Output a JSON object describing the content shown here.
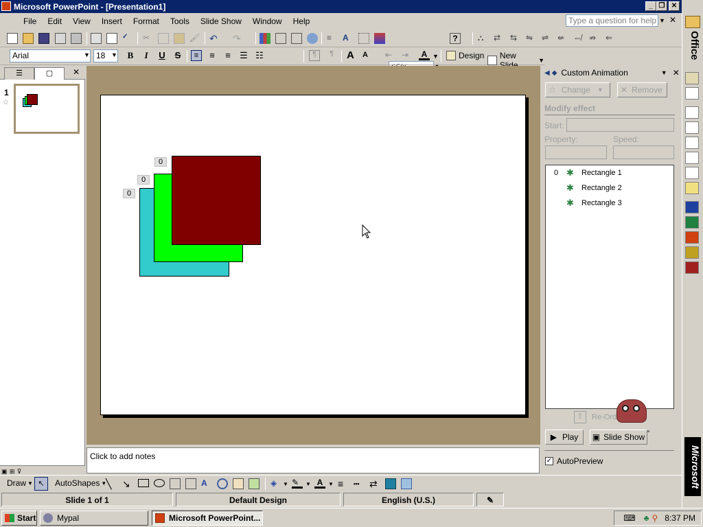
{
  "window": {
    "title": "Microsoft PowerPoint - [Presentation1]",
    "help_placeholder": "Type a question for help"
  },
  "menu": [
    "File",
    "Edit",
    "View",
    "Insert",
    "Format",
    "Tools",
    "Slide Show",
    "Window",
    "Help"
  ],
  "toolbar": {
    "zoom": "65%",
    "design_label": "Design",
    "new_slide_label": "New Slide",
    "font_name": "Arial",
    "font_size": "18"
  },
  "slides_pane": {
    "slide_number": "1"
  },
  "slide": {
    "rectangles": [
      {
        "name": "Rectangle 1",
        "color": "#33cccc",
        "order": "0"
      },
      {
        "name": "Rectangle 2",
        "color": "#00ff00",
        "order": "0"
      },
      {
        "name": "Rectangle 3",
        "color": "#800000",
        "order": "0"
      }
    ]
  },
  "notes": {
    "placeholder": "Click to add notes"
  },
  "task_pane": {
    "title": "Custom Animation",
    "change_label": "Change",
    "remove_label": "Remove",
    "modify_effect": "Modify effect",
    "start_label": "Start:",
    "property_label": "Property:",
    "speed_label": "Speed:",
    "list": [
      {
        "order": "0",
        "name": "Rectangle 1"
      },
      {
        "order": "",
        "name": "Rectangle 2"
      },
      {
        "order": "",
        "name": "Rectangle 3"
      }
    ],
    "reorder_label": "Re-Order",
    "play_label": "Play",
    "slideshow_label": "Slide Show",
    "autopreview_label": "AutoPreview"
  },
  "drawing_toolbar": {
    "draw_label": "Draw",
    "autoshapes_label": "AutoShapes"
  },
  "status": {
    "slide": "Slide 1 of 1",
    "design": "Default Design",
    "language": "English (U.S.)"
  },
  "taskbar": {
    "start_label": "Start",
    "items": [
      "Mypal",
      "Microsoft PowerPoint..."
    ],
    "time": "8:37 PM"
  },
  "office_bar": {
    "top_label": "Office",
    "bottom_label": "Microsoft"
  }
}
